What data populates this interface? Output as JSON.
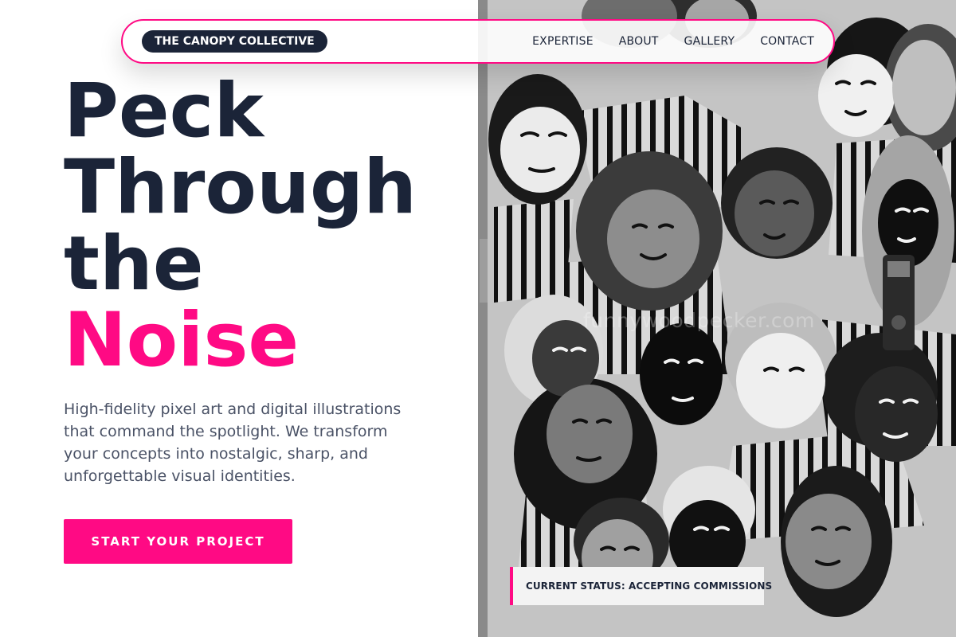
{
  "brand": {
    "name": "THE CANOPY COLLECTIVE"
  },
  "nav": {
    "links": [
      "EXPERTISE",
      "ABOUT",
      "GALLERY",
      "CONTACT"
    ]
  },
  "hero": {
    "title_lines": [
      "Peck",
      "Through",
      "the"
    ],
    "title_accent": "Noise",
    "description": "High-fidelity pixel art and digital illustrations that command the spotlight. We transform your concepts into nostalgic, sharp, and unforgettable visual identities.",
    "cta_label": "START YOUR PROJECT"
  },
  "mural": {
    "watermark": "funnywoodpecker.com",
    "status": "CURRENT STATUS: ACCEPTING COMMISSIONS"
  },
  "colors": {
    "accent": "#ff0a84",
    "navy": "#1b2438",
    "body_text": "#4a5266"
  }
}
